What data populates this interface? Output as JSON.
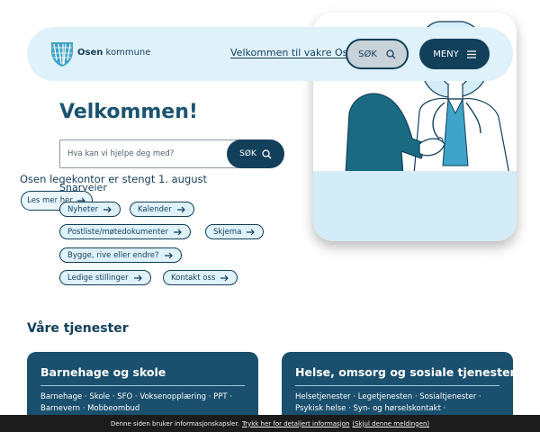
{
  "header": {
    "brand_bold": "Osen",
    "brand_rest": " kommune",
    "welcome_link": "Velkommen til vakre Osen",
    "search_label": "SØK",
    "menu_label": "MENY"
  },
  "hero": {
    "title": "Osen legekontor er stengt 1. august",
    "button_label": "Les mer her"
  },
  "main": {
    "title": "Velkommen!",
    "search_placeholder": "Hva kan vi hjelpe deg med?",
    "search_button": "SØK"
  },
  "shortcuts": {
    "title": "Snarveier",
    "items": [
      {
        "label": "Nyheter"
      },
      {
        "label": "Kalender"
      },
      {
        "label": "Postliste/møtedokumenter"
      },
      {
        "label": "Skjema"
      },
      {
        "label": "Bygge, rive eller endre?"
      },
      {
        "label": "Ledige stillinger"
      },
      {
        "label": "Kontakt oss"
      }
    ]
  },
  "services": {
    "title": "Våre tjenester",
    "cards": [
      {
        "title": "Barnehage og skole",
        "line1": "Barnehage · Skole · SFO · Voksenopplæring · PPT ·",
        "line2": "Barnevern · Mobbeombud"
      },
      {
        "title": "Helse, omsorg og sosiale tjenester",
        "line1": "Helsetjenester · Legetjenesten · Sosialtjenester ·",
        "line2": "Psykisk helse · Syn- og hørselskontakt ·"
      }
    ]
  },
  "cookie": {
    "text": "Denne siden bruker informasjonskapsler.",
    "link": "Trykk her for detaljert informasjon",
    "dismiss": "(Skjul denne meldingen)"
  },
  "colors": {
    "primary": "#123f5a",
    "light": "#dff1fb",
    "card": "#1a4f6d"
  },
  "icons": [
    "logo-shield-icon",
    "search-icon",
    "menu-icon",
    "arrow-right-icon"
  ]
}
